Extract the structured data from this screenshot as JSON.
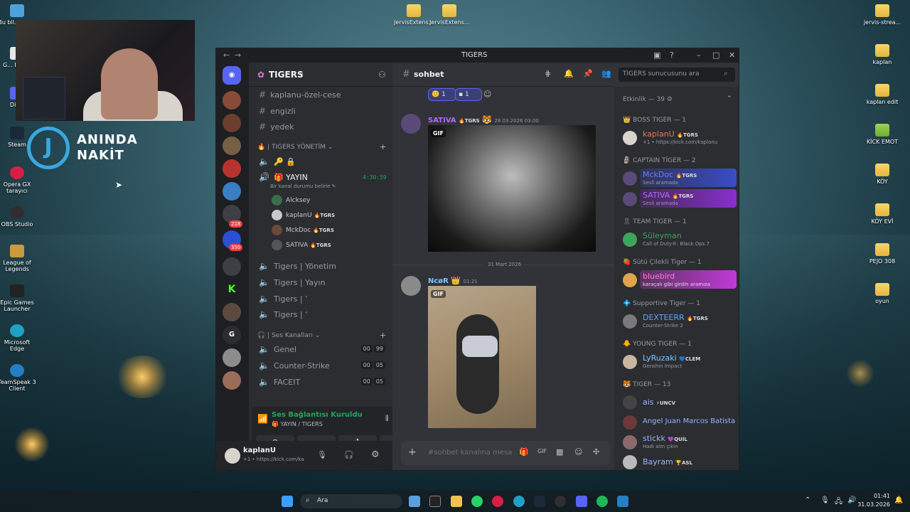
{
  "desktop": {
    "left_icons": [
      {
        "label": "Bu bil... - Ki..."
      },
      {
        "label": "G... Don..."
      },
      {
        "label": "Dis..."
      },
      {
        "label": "Steam"
      },
      {
        "label": "Opera GX tarayıcı"
      },
      {
        "label": "OBS Studio"
      },
      {
        "label": "League of Legends"
      },
      {
        "label": "Epic Games Launcher"
      },
      {
        "label": "Microsoft Edge"
      },
      {
        "label": "TeamSpeak 3 Client"
      }
    ],
    "top_icons": [
      {
        "label": "JervisExtens..."
      },
      {
        "label": "JervisExtens..."
      }
    ],
    "right_icons": [
      {
        "label": "jervis-strea..."
      },
      {
        "label": "kaplan"
      },
      {
        "label": "kaplan edit"
      },
      {
        "label": "KİCK EMOT"
      },
      {
        "label": "KÖY"
      },
      {
        "label": "KÖY EVİ"
      },
      {
        "label": "PEJO 308"
      },
      {
        "label": "oyun"
      }
    ],
    "overlay_logo": {
      "letter": "J",
      "line1": "ANINDA",
      "line2": "NAKİT"
    }
  },
  "window": {
    "title": "TIGERS",
    "server_badges": [
      "218",
      "350"
    ],
    "server_letter": "G",
    "guild_name": "TIGERS",
    "channels_top": [
      "kaplanu-özel-cese",
      "engizli",
      "yedek"
    ],
    "category_yonetim": "| TIGERS YÖNETİM",
    "yayin": {
      "name": "YAYIN",
      "timer": "4:30:59",
      "status": "Bir kanal durumu belirle"
    },
    "voice_users": [
      {
        "name": "Alcksey",
        "tag": ""
      },
      {
        "name": "kaplanU",
        "tag": "TGRS"
      },
      {
        "name": "MckDoc",
        "tag": "TGRS"
      },
      {
        "name": "SATIVA",
        "tag": "TGRS"
      }
    ],
    "voice_channels_mid": [
      "Tigers | Yönetim",
      "Tigers | Yayın",
      "Tigers | ʼ",
      "Tigers | ʼ"
    ],
    "category_ses": "| Ses Kanalları",
    "ses_channels": [
      {
        "name": "Genel",
        "a": "00",
        "b": "99"
      },
      {
        "name": "Counter-Strike",
        "a": "00",
        "b": "05"
      },
      {
        "name": "FACEIT",
        "a": "00",
        "b": "05"
      }
    ],
    "voice_panel": {
      "title": "Ses Bağlantısı Kuruldu",
      "sub": "YAYIN / TIGERS"
    },
    "user_panel": {
      "name": "kaplanU",
      "status": "+1 • https://kick.com/ka"
    },
    "chat": {
      "channel": "sohbet",
      "search_placeholder": "TIGERS sunucusunu ara",
      "reactions": [
        {
          "count": "1"
        },
        {
          "count": "1"
        }
      ],
      "msg1": {
        "author": "SATIVA",
        "tag": "TGRS",
        "time": "28.03.2026 03:00",
        "gif": "GIF"
      },
      "divider": "31 Mart 2026",
      "msg2": {
        "author": "NcøR",
        "time": "01:21",
        "gif": "GIF"
      },
      "input_placeholder": "#sohbet kanalına mesa..."
    },
    "members": {
      "activity_header": "Etkinlik — 39",
      "groups": [
        {
          "title": "BOSS TIGER — 1"
        },
        {
          "title": "CAPTAIN TİGER — 2"
        },
        {
          "title": "TEAM TIGER — 1"
        },
        {
          "title": "Sütü Çilekli Tiger — 1"
        },
        {
          "title": "Supportive Tiger — 1"
        },
        {
          "title": "YOUNG TIGER — 1"
        },
        {
          "title": "TIGER — 13"
        }
      ],
      "list": [
        {
          "name": "kaplanU",
          "tag": "TGRS",
          "status": "+1 • https://kick.com/kaplanu",
          "color": "#f26d5b"
        },
        {
          "name": "MckDoc",
          "tag": "TGRS",
          "status": "Sesli aramada",
          "color": "#6b7cff"
        },
        {
          "name": "SATIVA",
          "tag": "TGRS",
          "status": "Sesli aramada",
          "color": "#b468ff"
        },
        {
          "name": "Süleyman",
          "tag": "",
          "status": "Call of Duty®: Black Ops 7",
          "color": "#3ba55c"
        },
        {
          "name": "bluebird",
          "tag": "",
          "status": "karaçalı gibi girdin aramıza",
          "color": "#ff7bd8"
        },
        {
          "name": "DEXTEERR",
          "tag": "TGRS",
          "status": "Counter-Strike 2",
          "color": "#5aa7ff"
        },
        {
          "name": "LyRuzaki",
          "tag": "CLEM",
          "status": "Genshin Impact",
          "color": "#7fc4ff"
        },
        {
          "name": "ais",
          "tag": "UNCV",
          "status": "",
          "color": "#9bb3ff"
        },
        {
          "name": "Angel Juan Marcos Batista",
          "tag": "",
          "status": "",
          "color": "#9bb3ff"
        },
        {
          "name": "stickk",
          "tag": "QUİL",
          "status": "Hadi aim çıkın",
          "color": "#9bb3ff"
        },
        {
          "name": "Bayram",
          "tag": "ASL",
          "status": "",
          "color": "#9bb3ff"
        }
      ]
    }
  },
  "taskbar": {
    "search": "Ara",
    "time": "01:41",
    "date": "31.03.2026"
  }
}
